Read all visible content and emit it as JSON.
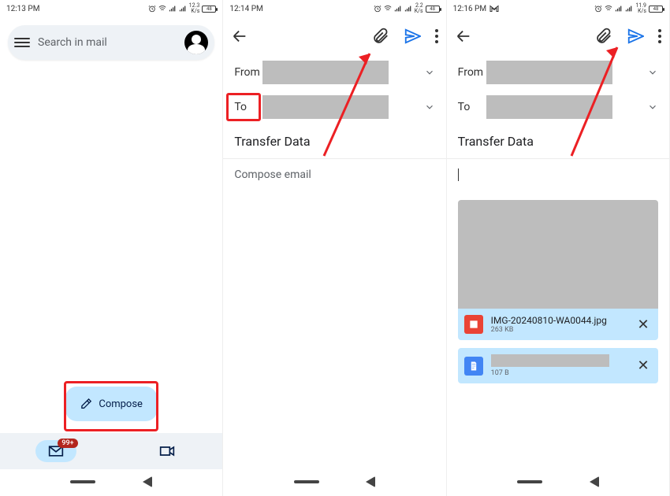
{
  "panels": [
    {
      "time": "12:13 PM",
      "rate": "12.3\nK/s",
      "batt": "48"
    },
    {
      "time": "12:14 PM",
      "rate": "2.2\nK/s",
      "batt": "48"
    },
    {
      "time": "12:16 PM",
      "rate": "11.9\nK/s",
      "batt": "48"
    }
  ],
  "inbox": {
    "search_placeholder": "Search in mail",
    "compose_label": "Compose",
    "mail_badge": "99+"
  },
  "compose": {
    "from_label": "From",
    "to_label": "To",
    "subject": "Transfer Data",
    "body_placeholder": "Compose email",
    "attachments": [
      {
        "name": "IMG-20240810-WA0044.jpg",
        "size": "263 KB",
        "type": "image"
      },
      {
        "name": "",
        "size": "107 B",
        "type": "doc"
      }
    ]
  }
}
